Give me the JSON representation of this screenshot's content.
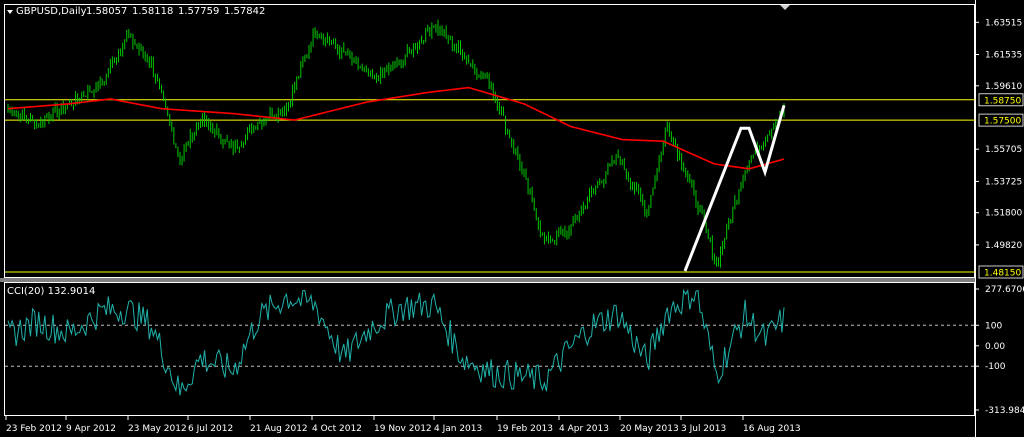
{
  "main": {
    "symbol_label": "GBPUSD,Daily",
    "ohlc": [
      "1.58057",
      "1.58118",
      "1.57759",
      "1.57842"
    ],
    "y_ticks": [
      "1.63515",
      "1.61535",
      "1.59610",
      "1.55705",
      "1.53725",
      "1.51800",
      "1.49820"
    ],
    "levels": [
      "1.58750",
      "1.57500",
      "1.48150"
    ]
  },
  "indicator": {
    "label": "CCI(20) 132.9014",
    "y_ticks": [
      "277.6706",
      "100",
      "0.00",
      "-100",
      "-313.9847"
    ]
  },
  "x_ticks": [
    "23 Feb 2012",
    "9 Apr 2012",
    "23 May 2012",
    "6 Jul 2012",
    "21 Aug 2012",
    "4 Oct 2012",
    "19 Nov 2012",
    "4 Jan 2013",
    "19 Feb 2013",
    "4 Apr 2013",
    "20 May 2013",
    "3 Jul 2013",
    "16 Aug 2013"
  ],
  "colors": {
    "background": "#000000",
    "candles": "#00c800",
    "moving_average": "#ff0000",
    "levels": "#ffff00",
    "cci": "#20b2aa",
    "trend_lines": "#ffffff",
    "axis_text": "#ffffff"
  },
  "chart_data": [
    {
      "type": "candlestick",
      "series": [
        {
          "x": [
            "23 Feb 2012",
            "9 Apr 2012",
            "23 May 2012",
            "6 Jul 2012",
            "21 Aug 2012",
            "4 Oct 2012",
            "19 Nov 2012",
            "4 Jan 2013",
            "19 Feb 2013",
            "4 Apr 2013",
            "20 May 2013",
            "3 Jul 2013",
            "16 Aug 2013"
          ],
          "close": [
            1.582,
            1.627,
            1.551,
            1.557,
            1.63,
            1.613,
            1.6,
            1.634,
            1.5,
            1.518,
            1.562,
            1.486,
            1.582
          ]
        },
        {
          "name": "moving average",
          "values": [
            1.582,
            1.585,
            1.588,
            1.579,
            1.575,
            1.585,
            1.592,
            1.595,
            1.579,
            1.563,
            1.562,
            1.545,
            1.551
          ]
        }
      ],
      "levels": [
        1.5875,
        1.575,
        1.4815
      ],
      "ylim": [
        1.4815,
        1.6452
      ]
    },
    {
      "type": "line",
      "series": [
        {
          "values": [
            50,
            180,
            -230,
            130,
            240,
            -60,
            100,
            200,
            -150,
            170,
            270,
            -140,
            133
          ]
        }
      ],
      "ylim": [
        -313.9847,
        277.6706
      ]
    }
  ]
}
